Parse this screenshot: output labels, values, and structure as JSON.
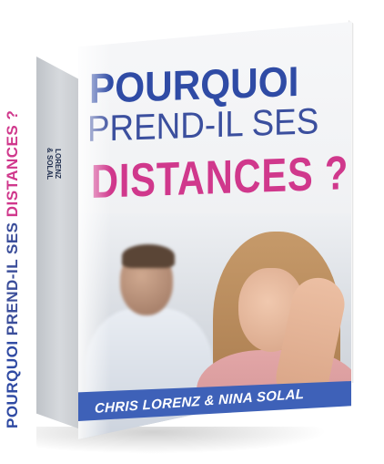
{
  "book": {
    "title_line1": "POURQUOI",
    "title_line2": "PREND-IL SES",
    "title_line3": "DISTANCES ?",
    "authors": "CHRIS LORENZ & NINA SOLAL",
    "spine_word1": "POURQUOI",
    "spine_word2": "PREND-IL SES",
    "spine_word3": "DISTANCES ?",
    "spine_author1": "LORENZ",
    "spine_author2": "& SOLAL"
  },
  "colors": {
    "title_blue": "#2f4ba5",
    "title_pink": "#d0388c",
    "banner_blue": "#3e61b8"
  }
}
